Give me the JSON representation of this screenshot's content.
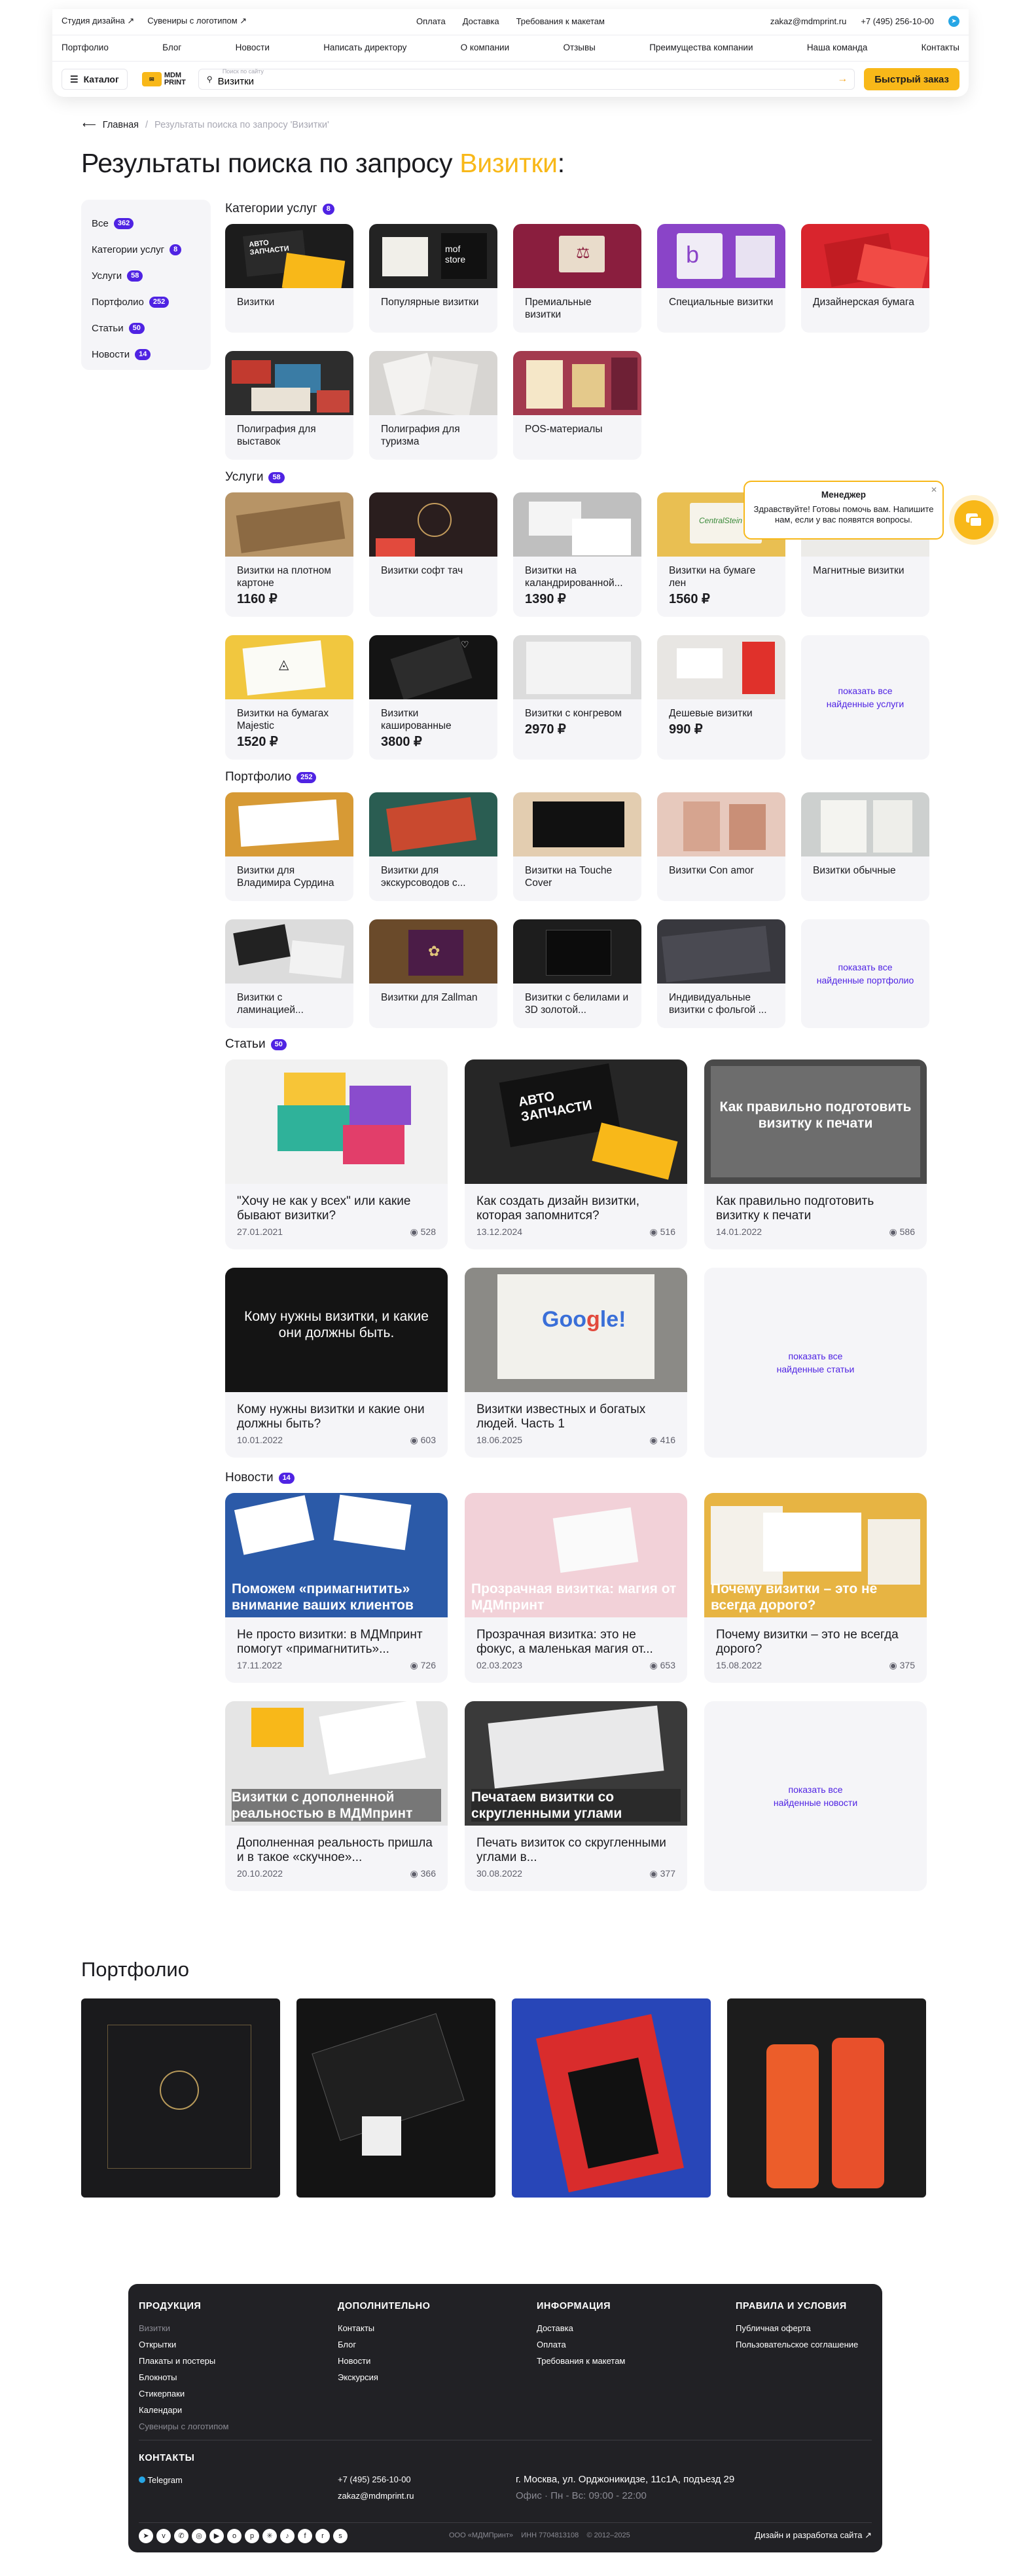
{
  "header": {
    "top_left": [
      "Студия дизайна ↗",
      "Сувениры с логотипом ↗"
    ],
    "top_mid": [
      "Оплата",
      "Доставка",
      "Требования к макетам"
    ],
    "email": "zakaz@mdmprint.ru",
    "phone": "+7 (495) 256-10-00",
    "nav": [
      "Портфолио",
      "Блог",
      "Новости",
      "Написать директору",
      "О компании",
      "Отзывы",
      "Преимущества компании",
      "Наша команда",
      "Контакты"
    ],
    "catalog": "Каталог",
    "logo": "MDM PRINT",
    "search_hint": "Поиск по сайту",
    "search_value": "Визитки",
    "quick_order": "Быстрый заказ"
  },
  "breadcrumb": {
    "home": "Главная",
    "current": "Результаты поиска по запросу 'Визитки'"
  },
  "title": {
    "prefix": "Результаты поиска по запросу ",
    "query": "Визитки",
    "suffix": ":"
  },
  "sidebar": [
    {
      "label": "Все",
      "count": "362"
    },
    {
      "label": "Категории услуг",
      "count": "8"
    },
    {
      "label": "Услуги",
      "count": "58"
    },
    {
      "label": "Портфолио",
      "count": "252"
    },
    {
      "label": "Статьи",
      "count": "50"
    },
    {
      "label": "Новости",
      "count": "14"
    }
  ],
  "sections": {
    "categories": {
      "label": "Категории услуг",
      "count": "8"
    },
    "services": {
      "label": "Услуги",
      "count": "58"
    },
    "portfolio": {
      "label": "Портфолио",
      "count": "252"
    },
    "articles": {
      "label": "Статьи",
      "count": "50"
    },
    "news": {
      "label": "Новости",
      "count": "14"
    }
  },
  "categories": [
    "Визитки",
    "Популярные визитки",
    "Премиальные визитки",
    "Специальные визитки",
    "Дизайнерская бумага",
    "Полиграфия для выставок",
    "Полиграфия для туризма",
    "POS-материалы"
  ],
  "services": [
    {
      "t": "Визитки на плотном картоне",
      "p": "1160 ₽"
    },
    {
      "t": "Визитки софт тач",
      "p": ""
    },
    {
      "t": "Визитки на каландрированной...",
      "p": "1390 ₽"
    },
    {
      "t": "Визитки на бумаге лен",
      "p": "1560 ₽"
    },
    {
      "t": "Магнитные визитки",
      "p": ""
    },
    {
      "t": "Визитки на бумагах Majestic",
      "p": "1520 ₽"
    },
    {
      "t": "Визитки кашированные",
      "p": "3800 ₽"
    },
    {
      "t": "Визитки с конгревом",
      "p": "2970 ₽"
    },
    {
      "t": "Дешевые визитки",
      "p": "990 ₽"
    }
  ],
  "services_more": "показать все\nнайденные услуги",
  "portfolio": [
    "Визитки для Владимира Сурдина",
    "Визитки для экскурсоводов с...",
    "Визитки на Touche Cover",
    "Визитки Con amor",
    "Визитки обычные",
    "Визитки с ламинацией...",
    "Визитки для Zallman",
    "Визитки с белилами и 3D золотой...",
    "Индивидуальные визитки с фольгой ..."
  ],
  "portfolio_more": "показать все\nнайденные портфолио",
  "articles": [
    {
      "t": "\"Хочу не как у всех\" или какие бывают визитки?",
      "d": "27.01.2021",
      "v": "528",
      "ov": ""
    },
    {
      "t": "Как создать дизайн визитки, которая запомнится?",
      "d": "13.12.2024",
      "v": "516",
      "ov": ""
    },
    {
      "t": "Как правильно подготовить визитку к печати",
      "d": "14.01.2022",
      "v": "586",
      "ov": "Как правильно подготовить визитку к печати"
    },
    {
      "t": "Кому нужны визитки и какие они должны быть?",
      "d": "10.01.2022",
      "v": "603",
      "ov": "Кому нужны визитки, и какие они должны быть."
    },
    {
      "t": "Визитки известных и богатых людей. Часть 1",
      "d": "18.06.2025",
      "v": "416",
      "ov": ""
    }
  ],
  "articles_more": "показать все\nнайденные статьи",
  "news": [
    {
      "t": "Не просто визитки: в МДМпринт помогут «примагнитить»...",
      "d": "17.11.2022",
      "v": "726",
      "ov": "Поможем «примагнитить» внимание ваших клиентов"
    },
    {
      "t": "Прозрачная визитка: это не фокус, а маленькая магия от...",
      "d": "02.03.2023",
      "v": "653",
      "ov": "Прозрачная визитка: магия от МДМпринт"
    },
    {
      "t": "Почему визитки – это не всегда дорого?",
      "d": "15.08.2022",
      "v": "375",
      "ov": "Почему визитки – это не всегда дорого?"
    },
    {
      "t": "Дополненная реальность пришла и в такое «скучное»...",
      "d": "20.10.2022",
      "v": "366",
      "ov": "Визитки с дополненной реальностью в МДМпринт"
    },
    {
      "t": "Печать визиток со скругленными углами в...",
      "d": "30.08.2022",
      "v": "377",
      "ov": "Печатаем визитки со скругленными углами"
    }
  ],
  "news_more": "показать все\nнайденные новости",
  "chat": {
    "title": "Менеджер",
    "text": "Здравствуйте! Готовы помочь вам. Напишите нам, если у вас появятся вопросы."
  },
  "portfolio_big": "Портфолио",
  "footer": {
    "col1": {
      "h": "ПРОДУКЦИЯ",
      "items": [
        "Визитки",
        "Открытки",
        "Плакаты и постеры",
        "Блокноты",
        "Стикерпаки",
        "Календари",
        "Сувениры с логотипом"
      ]
    },
    "col2": {
      "h": "ДОПОЛНИТЕЛЬНО",
      "items": [
        "Контакты",
        "Блог",
        "Новости",
        "Экскурсия"
      ]
    },
    "col3": {
      "h": "ИНФОРМАЦИЯ",
      "items": [
        "Доставка",
        "Оплата",
        "Требования к макетам"
      ]
    },
    "col4": {
      "h": "ПРАВИЛА И УСЛОВИЯ",
      "items": [
        "Публичная оферта",
        "Пользовательское соглашение"
      ]
    },
    "contacts": "КОНТАКТЫ",
    "telegram": "Telegram",
    "phone": "+7 (495) 256-10-00",
    "email": "zakaz@mdmprint.ru",
    "address": "г. Москва, ул. Орджоникидзе, 11с1А, подъезд 29",
    "hours": "Офис · Пн - Вс: 09:00 - 22:00",
    "legal": "ООО «МДМПринт»    ИНН 7704813108    © 2012–2025",
    "dev": "Дизайн и разработка сайта ↗"
  }
}
